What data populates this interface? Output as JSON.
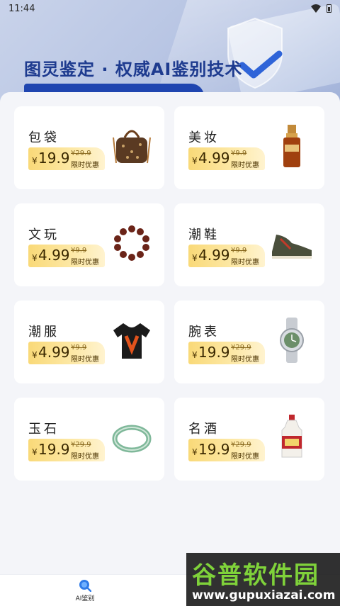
{
  "status_bar": {
    "time": "11:44"
  },
  "banner": {
    "title": "图灵鉴定 · 权威AI鉴别技术"
  },
  "categories": [
    {
      "name": "包袋",
      "currency": "¥",
      "price": "19.9",
      "original_price": "¥29.9",
      "promo": "限时优惠",
      "icon": "handbag-icon"
    },
    {
      "name": "美妆",
      "currency": "¥",
      "price": "4.99",
      "original_price": "¥9.9",
      "promo": "限时优惠",
      "icon": "serum-bottle-icon"
    },
    {
      "name": "文玩",
      "currency": "¥",
      "price": "4.99",
      "original_price": "¥9.9",
      "promo": "限时优惠",
      "icon": "bead-bracelet-icon"
    },
    {
      "name": "潮鞋",
      "currency": "¥",
      "price": "4.99",
      "original_price": "¥9.9",
      "promo": "限时优惠",
      "icon": "sneaker-icon"
    },
    {
      "name": "潮服",
      "currency": "¥",
      "price": "4.99",
      "original_price": "¥9.9",
      "promo": "限时优惠",
      "icon": "tshirt-icon"
    },
    {
      "name": "腕表",
      "currency": "¥",
      "price": "19.9",
      "original_price": "¥29.9",
      "promo": "限时优惠",
      "icon": "watch-icon"
    },
    {
      "name": "玉石",
      "currency": "¥",
      "price": "19.9",
      "original_price": "¥29.9",
      "promo": "限时优惠",
      "icon": "jade-bangle-icon"
    },
    {
      "name": "名酒",
      "currency": "¥",
      "price": "19.9",
      "original_price": "¥29.9",
      "promo": "限时优惠",
      "icon": "liquor-bottle-icon"
    }
  ],
  "tab_bar": {
    "items": [
      {
        "label": "AI鉴别",
        "icon": "search-icon",
        "active": true
      }
    ]
  },
  "watermark": {
    "title": "谷普软件园",
    "url": "www.gupuxiazai.com"
  },
  "colors": {
    "brand_blue": "#1e3b8f",
    "price_gold": "#f9d978",
    "accent_green": "#7fd23a"
  }
}
